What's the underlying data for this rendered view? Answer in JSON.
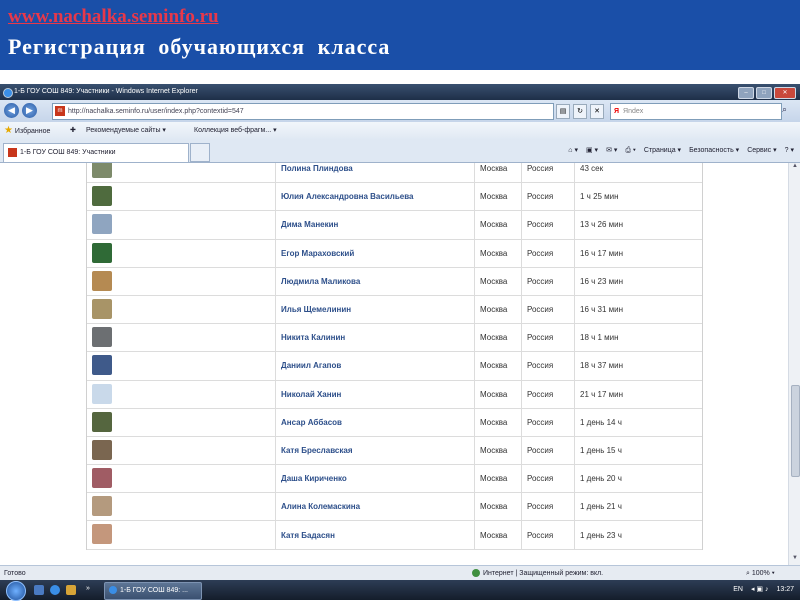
{
  "slide": {
    "link": "www.nachalka.seminfo.ru",
    "title": "Регистрация обучающихся класса"
  },
  "browser": {
    "window_title": "1-Б ГОУ СОШ 849: Участники - Windows Internet Explorer",
    "address": "http://nachalka.seminfo.ru/user/index.php?contextid=547",
    "search_placeholder": "Яndex",
    "search_brand": "Я",
    "favorites_label": "Избранное",
    "fav_links": [
      "Рекомендуемые сайты ▾",
      "Коллекция веб-фрагм... ▾"
    ],
    "tab_label": "1-Б ГОУ СОШ 849: Участники",
    "commands": [
      "Страница ▾",
      "Безопасность ▾",
      "Сервис ▾"
    ],
    "status_left": "Готово",
    "status_zone": "Интернет | Защищенный режим: вкл.",
    "zoom": "100%"
  },
  "participants": [
    {
      "name": "Полина Плиндова",
      "city": "Москва",
      "country": "Россия",
      "last_access": "43 сек",
      "avatar_color": "#7d8a6a"
    },
    {
      "name": "Юлия Александровна Васильева",
      "city": "Москва",
      "country": "Россия",
      "last_access": "1 ч 25 мин",
      "avatar_color": "#4f6b3e"
    },
    {
      "name": "Дима Манекин",
      "city": "Москва",
      "country": "Россия",
      "last_access": "13 ч 26 мин",
      "avatar_color": "#8fa5c0"
    },
    {
      "name": "Егор Мараховский",
      "city": "Москва",
      "country": "Россия",
      "last_access": "16 ч 17 мин",
      "avatar_color": "#2f6a36"
    },
    {
      "name": "Людмила Маликова",
      "city": "Москва",
      "country": "Россия",
      "last_access": "16 ч 23 мин",
      "avatar_color": "#b58a52"
    },
    {
      "name": "Илья Щемелинин",
      "city": "Москва",
      "country": "Россия",
      "last_access": "16 ч 31 мин",
      "avatar_color": "#a89467"
    },
    {
      "name": "Никита Калинин",
      "city": "Москва",
      "country": "Россия",
      "last_access": "18 ч 1 мин",
      "avatar_color": "#6c6f72"
    },
    {
      "name": "Даниил Агапов",
      "city": "Москва",
      "country": "Россия",
      "last_access": "18 ч 37 мин",
      "avatar_color": "#3f5a8a"
    },
    {
      "name": "Николай Ханин",
      "city": "Москва",
      "country": "Россия",
      "last_access": "21 ч 17 мин",
      "avatar_color": "#c9d9ea"
    },
    {
      "name": "Ансар Аббасов",
      "city": "Москва",
      "country": "Россия",
      "last_access": "1 день 14 ч",
      "avatar_color": "#55663f"
    },
    {
      "name": "Катя Бреславская",
      "city": "Москва",
      "country": "Россия",
      "last_access": "1 день 15 ч",
      "avatar_color": "#7a6650"
    },
    {
      "name": "Даша Кириченко",
      "city": "Москва",
      "country": "Россия",
      "last_access": "1 день 20 ч",
      "avatar_color": "#a05c64"
    },
    {
      "name": "Алина Колемаскина",
      "city": "Москва",
      "country": "Россия",
      "last_access": "1 день 21 ч",
      "avatar_color": "#b49a7e"
    },
    {
      "name": "Катя Бадасян",
      "city": "Москва",
      "country": "Россия",
      "last_access": "1 день 23 ч",
      "avatar_color": "#c4977c"
    }
  ],
  "taskbar": {
    "task_label": "1-Б ГОУ СОШ 849: ...",
    "lang": "EN",
    "clock": "13:27"
  }
}
